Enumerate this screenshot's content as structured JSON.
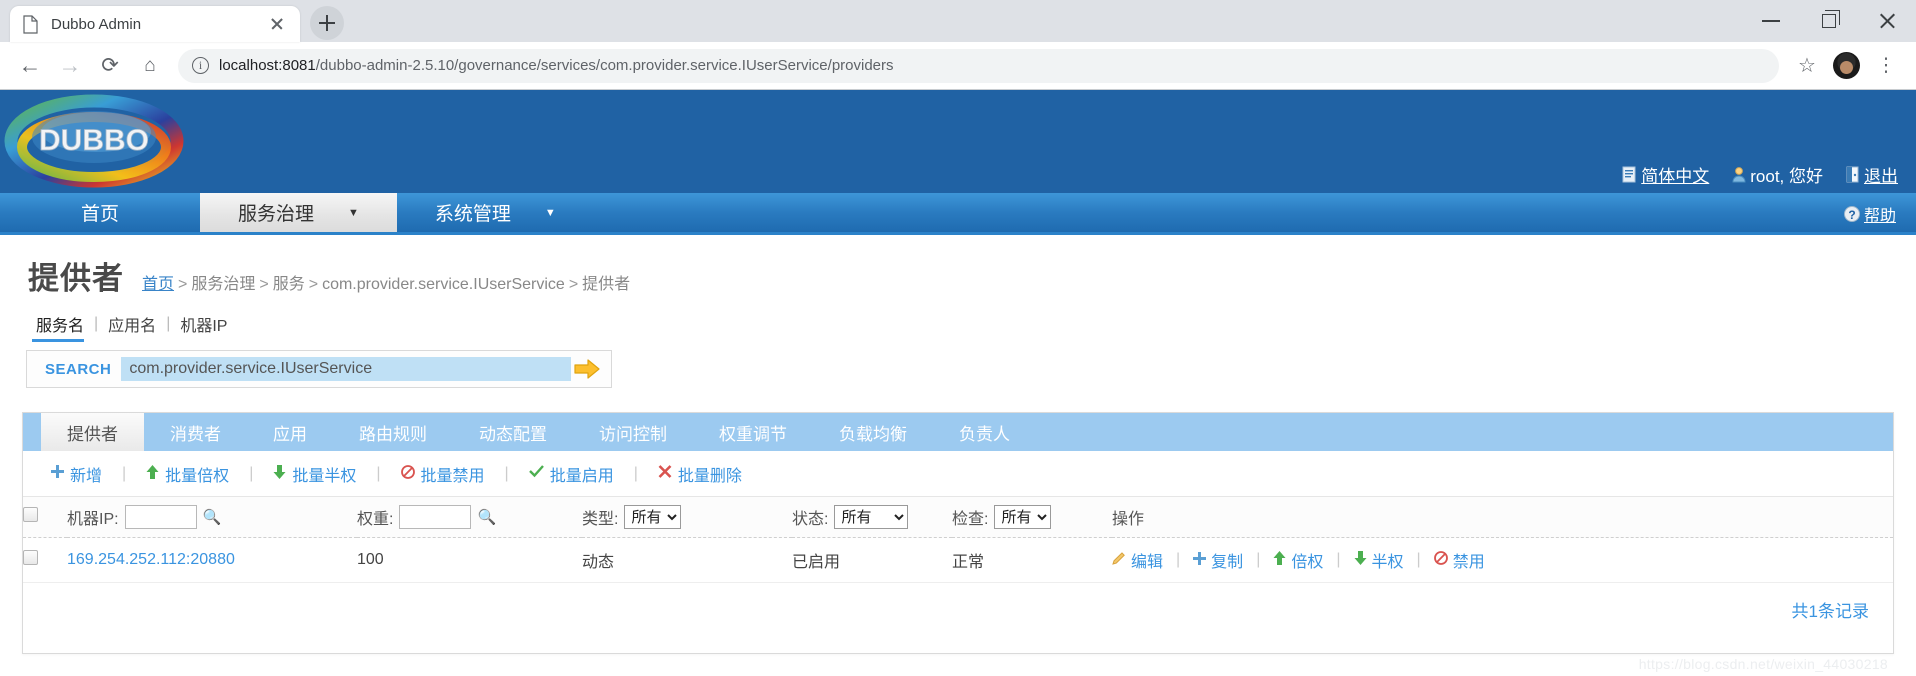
{
  "browser": {
    "tab": {
      "title": "Dubbo Admin",
      "favicon": "page-icon",
      "close": "×"
    },
    "new_tab_label": "+",
    "window": {
      "minimize": "–",
      "maximize": "□",
      "close": "×"
    },
    "nav": {
      "back": "←",
      "forward": "→",
      "reload": "⟳",
      "home": "⌂"
    },
    "omnibox": {
      "info_icon": "i",
      "host": "localhost:8081",
      "path": "/dubbo-admin-2.5.10/governance/services/com.provider.service.IUserService/providers",
      "star_icon": "☆"
    },
    "profile_icon": "avatar",
    "menu_icon": "⋮"
  },
  "header": {
    "logo_text": "DUBBO",
    "links": [
      {
        "icon": "language-icon",
        "label": "简体中文"
      },
      {
        "icon": "user-icon",
        "label": "root, 您好"
      },
      {
        "icon": "logout-icon",
        "label": "退出"
      }
    ]
  },
  "nav": {
    "items": [
      {
        "label": "首页",
        "active": false,
        "caret": false
      },
      {
        "label": "服务治理",
        "active": true,
        "caret": true
      },
      {
        "label": "系统管理",
        "active": false,
        "caret": true
      }
    ],
    "help": {
      "icon": "question-icon",
      "label": "帮助"
    }
  },
  "page": {
    "title": "提供者",
    "breadcrumb": {
      "home": "首页",
      "items": [
        "服务治理",
        "服务",
        "com.provider.service.IUserService",
        "提供者"
      ],
      "separator": ">"
    }
  },
  "search": {
    "tabs": [
      {
        "label": "服务名",
        "active": true
      },
      {
        "label": "应用名",
        "active": false
      },
      {
        "label": "机器IP",
        "active": false
      }
    ],
    "divider": "|",
    "label": "SEARCH",
    "value": "com.provider.service.IUserService",
    "placeholder": "",
    "go_icon": "arrow-right-icon"
  },
  "content_tabs": [
    {
      "label": "提供者",
      "active": true
    },
    {
      "label": "消费者",
      "active": false
    },
    {
      "label": "应用",
      "active": false
    },
    {
      "label": "路由规则",
      "active": false
    },
    {
      "label": "动态配置",
      "active": false
    },
    {
      "label": "访问控制",
      "active": false
    },
    {
      "label": "权重调节",
      "active": false
    },
    {
      "label": "负载均衡",
      "active": false
    },
    {
      "label": "负责人",
      "active": false
    }
  ],
  "toolbar": {
    "divider": "|",
    "buttons": [
      {
        "icon": "plus-icon",
        "label": "新增",
        "color": "#5a9fd4"
      },
      {
        "icon": "arrow-up-icon",
        "label": "批量倍权",
        "color": "#4caf50"
      },
      {
        "icon": "arrow-down-icon",
        "label": "批量半权",
        "color": "#4caf50"
      },
      {
        "icon": "prohibit-icon",
        "label": "批量禁用",
        "color": "#d9534f"
      },
      {
        "icon": "check-icon",
        "label": "批量启用",
        "color": "#4caf50"
      },
      {
        "icon": "cross-icon",
        "label": "批量删除",
        "color": "#d9534f"
      }
    ]
  },
  "table": {
    "headers": {
      "select_all": "checkbox",
      "ip_label": "机器IP:",
      "ip_filter_value": "",
      "weight_label": "权重:",
      "weight_filter_value": "",
      "type_label": "类型:",
      "type_value": "所有",
      "status_label": "状态:",
      "status_value": "所有",
      "check_label": "检查:",
      "check_value": "所有",
      "actions_label": "操作",
      "search_icon": "magnifier-icon"
    },
    "select_options": [
      "所有"
    ],
    "rows": [
      {
        "selected": false,
        "ip": "169.254.252.112:20880",
        "weight": "100",
        "type": "动态",
        "status": "已启用",
        "check": "正常",
        "actions": [
          {
            "icon": "pencil-icon",
            "label": "编辑",
            "color": "#e8a33d"
          },
          {
            "icon": "plus-icon",
            "label": "复制",
            "color": "#5a9fd4"
          },
          {
            "icon": "arrow-up-icon",
            "label": "倍权",
            "color": "#4caf50"
          },
          {
            "icon": "arrow-down-icon",
            "label": "半权",
            "color": "#4caf50"
          },
          {
            "icon": "prohibit-icon",
            "label": "禁用",
            "color": "#d9534f"
          }
        ],
        "action_divider": "|"
      }
    ],
    "record_count": "共1条记录"
  },
  "watermark": "https://blog.csdn.net/weixin_44030218",
  "colors": {
    "brand_blue": "#2062a4",
    "nav_blue": "#2a7bc0",
    "link_blue": "#3a94e0",
    "tab_blue": "#9ccaf0",
    "green": "#3aa03a",
    "orange": "#f0a830"
  }
}
